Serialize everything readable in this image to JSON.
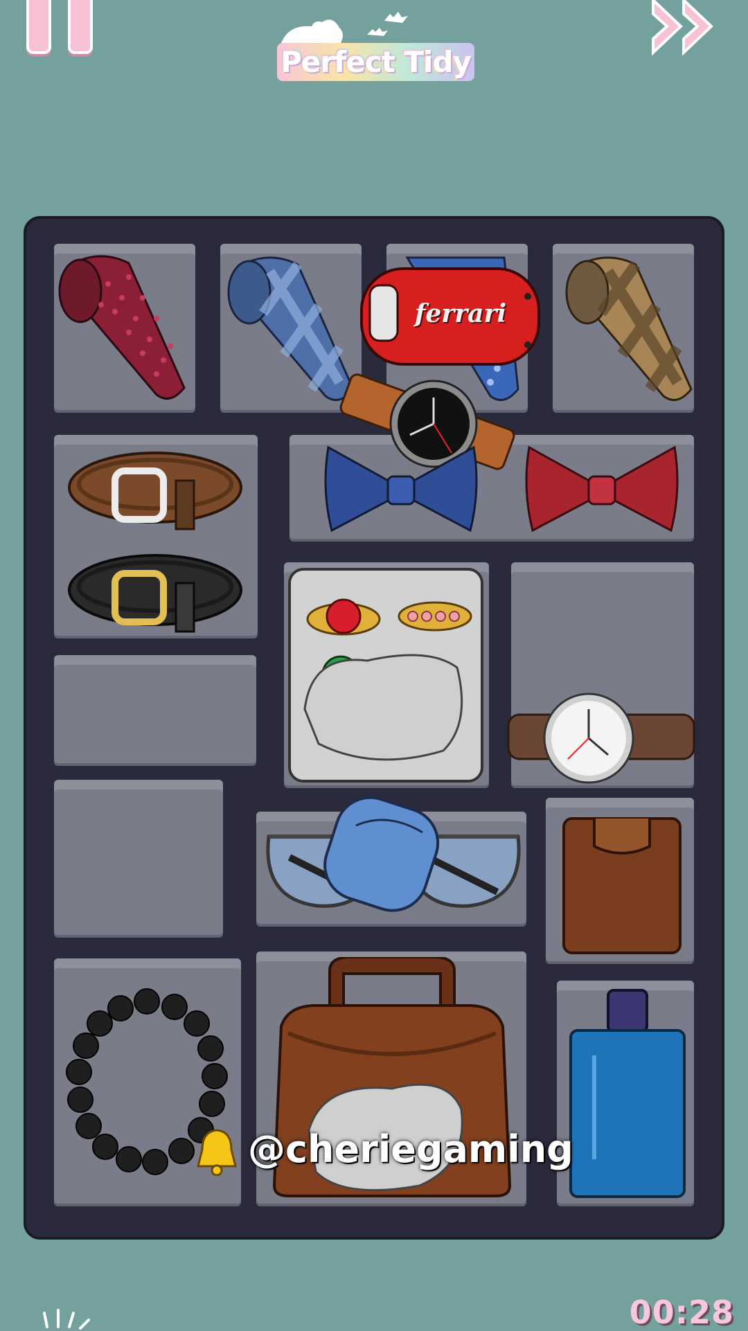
{
  "header": {
    "logo": "Perfect Tidy",
    "pause_icon": "pause-icon",
    "skip_icon": "fast-forward-icon"
  },
  "board": {
    "slots": [
      "tie",
      "tie",
      "tie",
      "tie",
      "belts",
      "bow-ties",
      "rings",
      "watch",
      "empty",
      "empty",
      "sunglasses",
      "wallet",
      "bracelet",
      "bag",
      "perfume"
    ],
    "items": {
      "car_key_label": "ferrari"
    }
  },
  "overlay": {
    "watermark": "@cheriegaming",
    "bell_icon": "bell-icon"
  },
  "footer": {
    "timer": "00:28"
  },
  "colors": {
    "background": "#74a19d",
    "board": "#2a2a3c",
    "slot": "#7a7c89",
    "accent_pink": "#f7c1d6"
  }
}
